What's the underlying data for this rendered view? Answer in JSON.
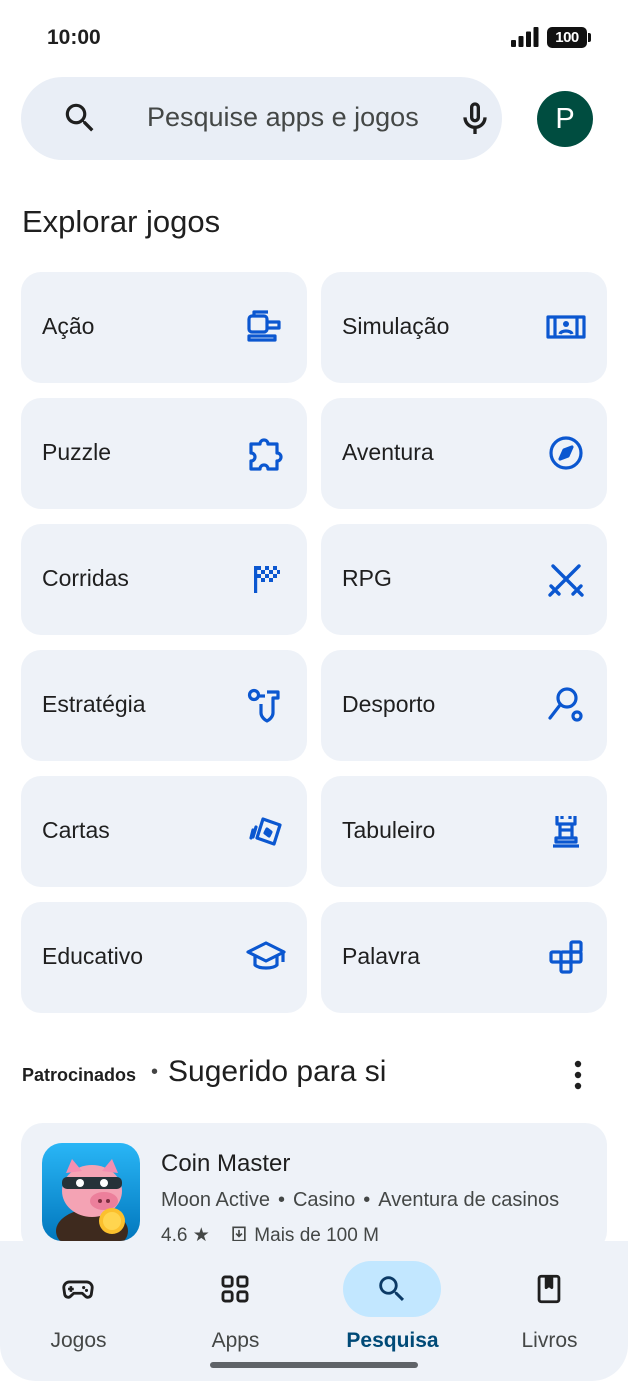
{
  "status_bar": {
    "time": "10:00",
    "battery": "100"
  },
  "search": {
    "placeholder": "Pesquise apps e jogos",
    "avatar_letter": "P"
  },
  "explore": {
    "title": "Explorar jogos",
    "categories": [
      {
        "label": "Ação",
        "icon": "action-icon"
      },
      {
        "label": "Simulação",
        "icon": "simulation-icon"
      },
      {
        "label": "Puzzle",
        "icon": "puzzle-icon"
      },
      {
        "label": "Aventura",
        "icon": "compass-icon"
      },
      {
        "label": "Corridas",
        "icon": "checkered-flag-icon"
      },
      {
        "label": "RPG",
        "icon": "swords-icon"
      },
      {
        "label": "Estratégia",
        "icon": "strategy-icon"
      },
      {
        "label": "Desporto",
        "icon": "sports-icon"
      },
      {
        "label": "Cartas",
        "icon": "cards-icon"
      },
      {
        "label": "Tabuleiro",
        "icon": "chess-rook-icon"
      },
      {
        "label": "Educativo",
        "icon": "graduation-cap-icon"
      },
      {
        "label": "Palavra",
        "icon": "word-blocks-icon"
      }
    ]
  },
  "suggested": {
    "sponsored_label": "Patrocinados",
    "dot": "•",
    "title": "Sugerido para si",
    "app": {
      "name": "Coin Master",
      "developer": "Moon Active",
      "tags": [
        "Casino",
        "Aventura de casinos"
      ],
      "separator": "•",
      "rating": "4,6 ★",
      "downloads": "Mais de 100 M"
    }
  },
  "bottom_nav": {
    "items": [
      {
        "label": "Jogos",
        "icon": "gamepad-icon",
        "active": false
      },
      {
        "label": "Apps",
        "icon": "apps-grid-icon",
        "active": false
      },
      {
        "label": "Pesquisa",
        "icon": "search-icon",
        "active": true
      },
      {
        "label": "Livros",
        "icon": "book-icon",
        "active": false
      }
    ]
  },
  "colors": {
    "accent": "#0b57d0",
    "tile_bg": "#eef2f8",
    "search_bg": "#e9eef6",
    "avatar": "#004d40",
    "active_pill": "#c2e7ff"
  }
}
